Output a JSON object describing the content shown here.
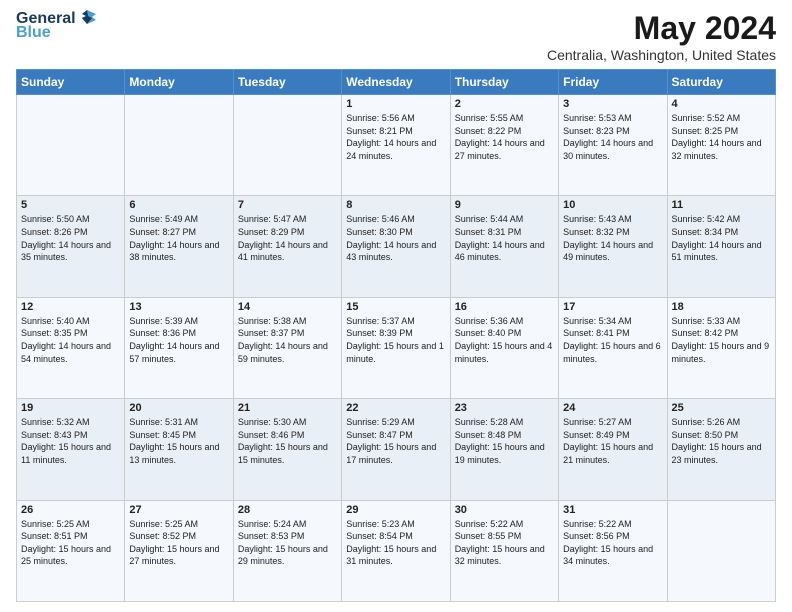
{
  "header": {
    "logo_general": "General",
    "logo_blue": "Blue",
    "main_title": "May 2024",
    "subtitle": "Centralia, Washington, United States"
  },
  "days_of_week": [
    "Sunday",
    "Monday",
    "Tuesday",
    "Wednesday",
    "Thursday",
    "Friday",
    "Saturday"
  ],
  "weeks": [
    [
      {
        "day": "",
        "sunrise": "",
        "sunset": "",
        "daylight": ""
      },
      {
        "day": "",
        "sunrise": "",
        "sunset": "",
        "daylight": ""
      },
      {
        "day": "",
        "sunrise": "",
        "sunset": "",
        "daylight": ""
      },
      {
        "day": "1",
        "sunrise": "Sunrise: 5:56 AM",
        "sunset": "Sunset: 8:21 PM",
        "daylight": "Daylight: 14 hours and 24 minutes."
      },
      {
        "day": "2",
        "sunrise": "Sunrise: 5:55 AM",
        "sunset": "Sunset: 8:22 PM",
        "daylight": "Daylight: 14 hours and 27 minutes."
      },
      {
        "day": "3",
        "sunrise": "Sunrise: 5:53 AM",
        "sunset": "Sunset: 8:23 PM",
        "daylight": "Daylight: 14 hours and 30 minutes."
      },
      {
        "day": "4",
        "sunrise": "Sunrise: 5:52 AM",
        "sunset": "Sunset: 8:25 PM",
        "daylight": "Daylight: 14 hours and 32 minutes."
      }
    ],
    [
      {
        "day": "5",
        "sunrise": "Sunrise: 5:50 AM",
        "sunset": "Sunset: 8:26 PM",
        "daylight": "Daylight: 14 hours and 35 minutes."
      },
      {
        "day": "6",
        "sunrise": "Sunrise: 5:49 AM",
        "sunset": "Sunset: 8:27 PM",
        "daylight": "Daylight: 14 hours and 38 minutes."
      },
      {
        "day": "7",
        "sunrise": "Sunrise: 5:47 AM",
        "sunset": "Sunset: 8:29 PM",
        "daylight": "Daylight: 14 hours and 41 minutes."
      },
      {
        "day": "8",
        "sunrise": "Sunrise: 5:46 AM",
        "sunset": "Sunset: 8:30 PM",
        "daylight": "Daylight: 14 hours and 43 minutes."
      },
      {
        "day": "9",
        "sunrise": "Sunrise: 5:44 AM",
        "sunset": "Sunset: 8:31 PM",
        "daylight": "Daylight: 14 hours and 46 minutes."
      },
      {
        "day": "10",
        "sunrise": "Sunrise: 5:43 AM",
        "sunset": "Sunset: 8:32 PM",
        "daylight": "Daylight: 14 hours and 49 minutes."
      },
      {
        "day": "11",
        "sunrise": "Sunrise: 5:42 AM",
        "sunset": "Sunset: 8:34 PM",
        "daylight": "Daylight: 14 hours and 51 minutes."
      }
    ],
    [
      {
        "day": "12",
        "sunrise": "Sunrise: 5:40 AM",
        "sunset": "Sunset: 8:35 PM",
        "daylight": "Daylight: 14 hours and 54 minutes."
      },
      {
        "day": "13",
        "sunrise": "Sunrise: 5:39 AM",
        "sunset": "Sunset: 8:36 PM",
        "daylight": "Daylight: 14 hours and 57 minutes."
      },
      {
        "day": "14",
        "sunrise": "Sunrise: 5:38 AM",
        "sunset": "Sunset: 8:37 PM",
        "daylight": "Daylight: 14 hours and 59 minutes."
      },
      {
        "day": "15",
        "sunrise": "Sunrise: 5:37 AM",
        "sunset": "Sunset: 8:39 PM",
        "daylight": "Daylight: 15 hours and 1 minute."
      },
      {
        "day": "16",
        "sunrise": "Sunrise: 5:36 AM",
        "sunset": "Sunset: 8:40 PM",
        "daylight": "Daylight: 15 hours and 4 minutes."
      },
      {
        "day": "17",
        "sunrise": "Sunrise: 5:34 AM",
        "sunset": "Sunset: 8:41 PM",
        "daylight": "Daylight: 15 hours and 6 minutes."
      },
      {
        "day": "18",
        "sunrise": "Sunrise: 5:33 AM",
        "sunset": "Sunset: 8:42 PM",
        "daylight": "Daylight: 15 hours and 9 minutes."
      }
    ],
    [
      {
        "day": "19",
        "sunrise": "Sunrise: 5:32 AM",
        "sunset": "Sunset: 8:43 PM",
        "daylight": "Daylight: 15 hours and 11 minutes."
      },
      {
        "day": "20",
        "sunrise": "Sunrise: 5:31 AM",
        "sunset": "Sunset: 8:45 PM",
        "daylight": "Daylight: 15 hours and 13 minutes."
      },
      {
        "day": "21",
        "sunrise": "Sunrise: 5:30 AM",
        "sunset": "Sunset: 8:46 PM",
        "daylight": "Daylight: 15 hours and 15 minutes."
      },
      {
        "day": "22",
        "sunrise": "Sunrise: 5:29 AM",
        "sunset": "Sunset: 8:47 PM",
        "daylight": "Daylight: 15 hours and 17 minutes."
      },
      {
        "day": "23",
        "sunrise": "Sunrise: 5:28 AM",
        "sunset": "Sunset: 8:48 PM",
        "daylight": "Daylight: 15 hours and 19 minutes."
      },
      {
        "day": "24",
        "sunrise": "Sunrise: 5:27 AM",
        "sunset": "Sunset: 8:49 PM",
        "daylight": "Daylight: 15 hours and 21 minutes."
      },
      {
        "day": "25",
        "sunrise": "Sunrise: 5:26 AM",
        "sunset": "Sunset: 8:50 PM",
        "daylight": "Daylight: 15 hours and 23 minutes."
      }
    ],
    [
      {
        "day": "26",
        "sunrise": "Sunrise: 5:25 AM",
        "sunset": "Sunset: 8:51 PM",
        "daylight": "Daylight: 15 hours and 25 minutes."
      },
      {
        "day": "27",
        "sunrise": "Sunrise: 5:25 AM",
        "sunset": "Sunset: 8:52 PM",
        "daylight": "Daylight: 15 hours and 27 minutes."
      },
      {
        "day": "28",
        "sunrise": "Sunrise: 5:24 AM",
        "sunset": "Sunset: 8:53 PM",
        "daylight": "Daylight: 15 hours and 29 minutes."
      },
      {
        "day": "29",
        "sunrise": "Sunrise: 5:23 AM",
        "sunset": "Sunset: 8:54 PM",
        "daylight": "Daylight: 15 hours and 31 minutes."
      },
      {
        "day": "30",
        "sunrise": "Sunrise: 5:22 AM",
        "sunset": "Sunset: 8:55 PM",
        "daylight": "Daylight: 15 hours and 32 minutes."
      },
      {
        "day": "31",
        "sunrise": "Sunrise: 5:22 AM",
        "sunset": "Sunset: 8:56 PM",
        "daylight": "Daylight: 15 hours and 34 minutes."
      },
      {
        "day": "",
        "sunrise": "",
        "sunset": "",
        "daylight": ""
      }
    ]
  ]
}
